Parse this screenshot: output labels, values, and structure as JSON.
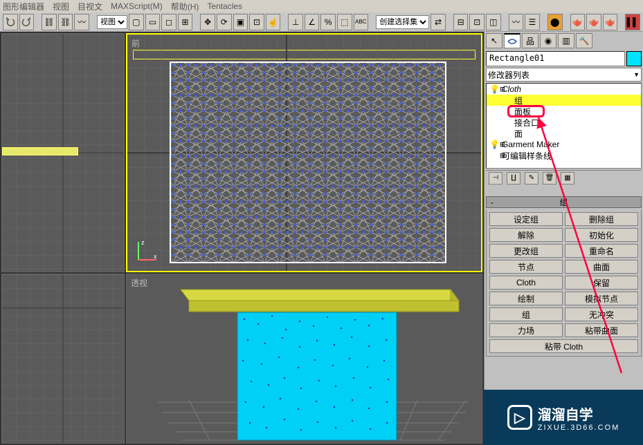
{
  "menu": [
    "图形编辑器",
    "视图",
    "目视文",
    "MAXScript(M)",
    "帮助(H)",
    "Tentacles"
  ],
  "toolbar": {
    "view_dd": "视图",
    "selset_dd": "创建选择集"
  },
  "viewports": {
    "front": "前",
    "persp": "透视",
    "axis_x": "x",
    "axis_z": "z"
  },
  "panel": {
    "obj_name": "Rectangle01",
    "mod_list": "修改器列表",
    "stack": {
      "cloth": "Cloth",
      "group": "组",
      "face": "面板",
      "joint": "接合口",
      "face2": "面",
      "garment": "Garment Maker",
      "editable": "可编辑样条线"
    },
    "rollout_title": "组",
    "btns": {
      "set_group": "设定组",
      "del_group": "删除组",
      "release": "解除",
      "init": "初始化",
      "change": "更改组",
      "rename": "重命名",
      "node": "节点",
      "surface": "曲面",
      "cloth": "Cloth",
      "keep": "保留",
      "draw": "绘制",
      "simnode": "模拟节点",
      "group": "组",
      "noconflict": "无冲突",
      "force": "力场",
      "stickcurve": "粘带曲面",
      "stickcloth": "粘带 Cloth"
    }
  },
  "watermark": {
    "title": "溜溜自学",
    "sub": "ZIXUE.3D66.COM"
  },
  "colors": {
    "highlight": "#ffff33",
    "obj": "#00e5ff",
    "anno": "#ff0040"
  }
}
